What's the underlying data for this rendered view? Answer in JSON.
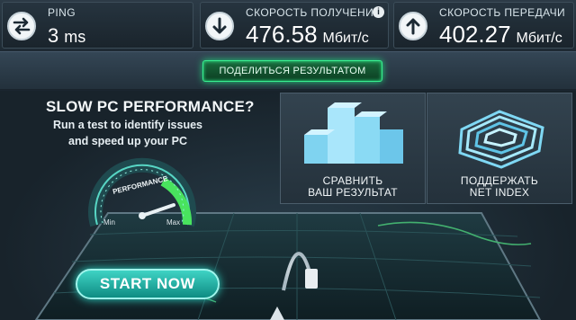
{
  "stats": {
    "ping": {
      "label": "PING",
      "value": "3",
      "unit": "ms",
      "icon": "swap-arrows-icon"
    },
    "download": {
      "label": "СКОРОСТЬ ПОЛУЧЕНИЯ",
      "value": "476.58",
      "unit": "Мбит/с",
      "icon": "arrow-down-icon",
      "info": "i"
    },
    "upload": {
      "label": "СКОРОСТЬ ПЕРЕДАЧИ",
      "value": "402.27",
      "unit": "Мбит/с",
      "icon": "arrow-up-icon"
    }
  },
  "share_button": "ПОДЕЛИТЬСЯ РЕЗУЛЬТАТОМ",
  "ad": {
    "title": "SLOW PC PERFORMANCE?",
    "line1": "Run a test to identify issues",
    "line2": "and speed up your PC",
    "gauge": {
      "label": "PERFORMANCE",
      "min": "Min",
      "max": "Max"
    },
    "button": "START NOW"
  },
  "compare_panel": {
    "line1": "СРАВНИТЬ",
    "line2": "ВАШ РЕЗУЛЬТАТ"
  },
  "support_panel": {
    "line1": "ПОДДЕРЖАТЬ",
    "line2": "NET INDEX"
  },
  "colors": {
    "accent_green": "#38f090",
    "accent_teal": "#2fd9c8",
    "panel_bg": "#24313b"
  }
}
